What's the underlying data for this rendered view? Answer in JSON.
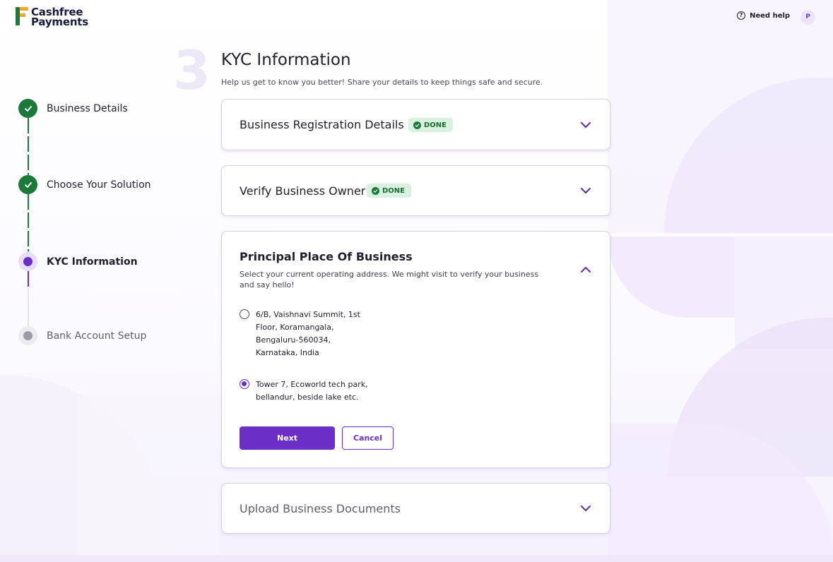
{
  "brand": {
    "line1": "Cashfree",
    "line2": "Payments"
  },
  "header": {
    "help_label": "Need help",
    "avatar_initial": "P"
  },
  "stepper": {
    "steps": [
      {
        "label": "Business Details",
        "status": "done"
      },
      {
        "label": "Choose Your Solution",
        "status": "done"
      },
      {
        "label": "KYC Information",
        "status": "active"
      },
      {
        "label": "Bank Account Setup",
        "status": "pending"
      }
    ]
  },
  "main": {
    "step_number": "3",
    "title": "KYC Information",
    "subtitle": "Help us get to know you better! Share your details to keep things safe and secure."
  },
  "sections": [
    {
      "title": "Business Registration Details",
      "badge": "DONE"
    },
    {
      "title": "Verify Business Owner",
      "badge": "DONE"
    },
    {
      "title": "Principal Place Of Business",
      "description": "Select your current operating address. We might visit to verify your business and say hello!",
      "options": [
        {
          "lines": [
            "6/B, Vaishnavi Summit, 1st",
            "Floor, Koramangala,",
            "Bengaluru-560034,",
            "Karnataka, India"
          ],
          "selected": false
        },
        {
          "lines": [
            "Tower 7, Ecoworld tech park,",
            "bellandur, beside lake etc."
          ],
          "selected": true
        }
      ],
      "next_label": "Next",
      "cancel_label": "Cancel"
    },
    {
      "title": "Upload Business Documents"
    }
  ],
  "colors": {
    "accent": "#6b2fc8",
    "success": "#1b7a3a",
    "badge_bg": "#d9f2df"
  }
}
